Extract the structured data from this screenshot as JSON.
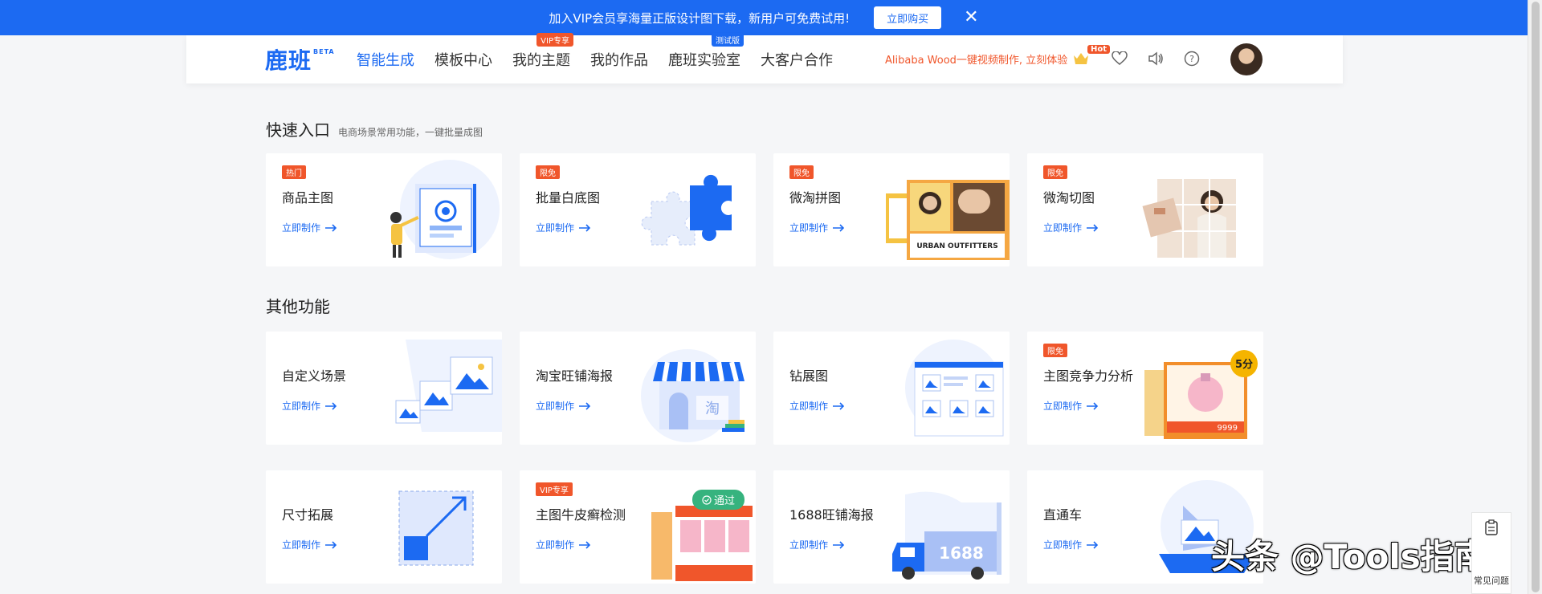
{
  "promo": {
    "text": "加入VIP会员享海量正版设计图下载，新用户可免费试用!",
    "button": "立即购买"
  },
  "header": {
    "logo": "鹿班",
    "logo_tag": "BETA",
    "nav": [
      {
        "label": "智能生成",
        "badge": ""
      },
      {
        "label": "模板中心",
        "badge": ""
      },
      {
        "label": "我的主题",
        "badge": "VIP专享"
      },
      {
        "label": "我的作品",
        "badge": ""
      },
      {
        "label": "鹿班实验室",
        "badge": "测试版"
      },
      {
        "label": "大客户合作",
        "badge": ""
      }
    ],
    "promo_link": "Alibaba Wood一键视频制作, 立刻体验",
    "hot_tag": "Hot"
  },
  "quick": {
    "title": "快速入口",
    "subtitle": "电商场景常用功能，一键批量成图",
    "cards": [
      {
        "tag": "热门",
        "title": "商品主图",
        "link": "立即制作"
      },
      {
        "tag": "限免",
        "title": "批量白底图",
        "link": "立即制作"
      },
      {
        "tag": "限免",
        "title": "微淘拼图",
        "link": "立即制作"
      },
      {
        "tag": "限免",
        "title": "微淘切图",
        "link": "立即制作"
      }
    ]
  },
  "other": {
    "title": "其他功能",
    "cards": [
      {
        "tag": "",
        "title": "自定义场景",
        "link": "立即制作"
      },
      {
        "tag": "",
        "title": "淘宝旺铺海报",
        "link": "立即制作"
      },
      {
        "tag": "",
        "title": "钻展图",
        "link": "立即制作"
      },
      {
        "tag": "限免",
        "title": "主图竞争力分析",
        "link": "立即制作"
      },
      {
        "tag": "",
        "title": "尺寸拓展",
        "link": "立即制作"
      },
      {
        "tag": "VIP专享",
        "title": "主图牛皮癣检测",
        "link": "立即制作"
      },
      {
        "tag": "",
        "title": "1688旺铺海报",
        "link": "立即制作"
      },
      {
        "tag": "",
        "title": "直通车",
        "link": "立即制作"
      }
    ]
  },
  "illustration_text": {
    "urban": "URBAN OUTFITTERS",
    "score": "5分",
    "taobao_char": "淘",
    "truck": "1688",
    "price": "9999"
  },
  "pass_badge": "通过",
  "help": "常见问题",
  "watermark": "头条 @Tools指南",
  "colors": {
    "primary": "#1c6af2",
    "tag": "#f0562b",
    "pass": "#36b37e"
  }
}
